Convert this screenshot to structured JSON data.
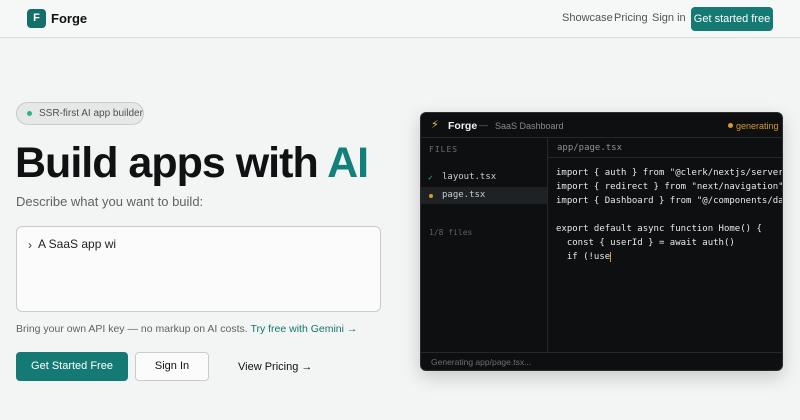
{
  "nav": {
    "logo_letter": "F",
    "brand": "Forge",
    "links": [
      "Showcase",
      "Pricing",
      "Sign in"
    ],
    "cta": "Get started free"
  },
  "hero": {
    "badge": "SSR-first AI app builder",
    "headline_main": "Build apps with ",
    "headline_accent": "AI",
    "describe_label": "Describe what you want to build:",
    "prompt_caret": "›",
    "prompt_value": "A SaaS app wi",
    "byok_text": "Bring your own API key — no markup on AI costs.",
    "byok_link": "Try free with Gemini →",
    "primary_button": "Get Started Free",
    "secondary_button": "Sign In",
    "pricing_link": "View Pricing →"
  },
  "editor": {
    "bolt": "⚡",
    "title": "Forge",
    "separator": "—",
    "project": "SaaS Dashboard",
    "status": "generating",
    "files_label": "FILES",
    "files": [
      {
        "name": "layout.tsx",
        "state": "done"
      },
      {
        "name": "page.tsx",
        "state": "active"
      }
    ],
    "file_count": "1/8 files",
    "active_tab": "app/page.tsx",
    "code_lines": [
      "import { auth } from \"@clerk/nextjs/server\"",
      "import { redirect } from \"next/navigation\"",
      "import { Dashboard } from \"@/components/dashboard\"",
      "",
      "export default async function Home() {",
      "  const { userId } = await auth()",
      "  if (!use"
    ],
    "footer": "Generating app/page.tsx..."
  },
  "colors": {
    "accent": "#147a73",
    "status": "#d69a2d",
    "editor_bg": "#0e0f10"
  }
}
